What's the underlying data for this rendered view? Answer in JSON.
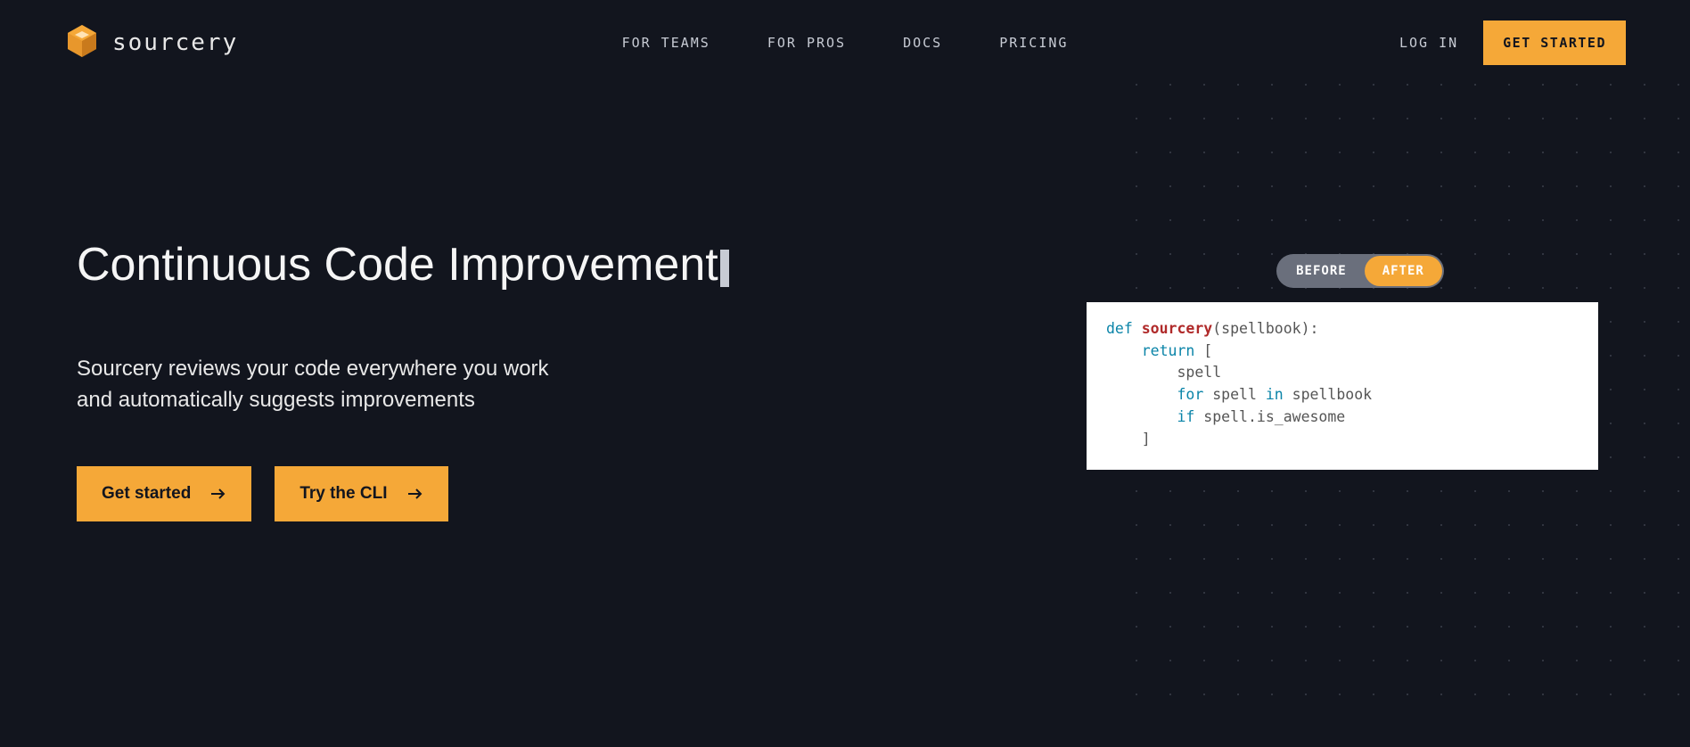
{
  "header": {
    "brand": "sourcery",
    "nav": {
      "for_teams": "FOR TEAMS",
      "for_pros": "FOR PROS",
      "docs": "DOCS",
      "pricing": "PRICING"
    },
    "login": "LOG IN",
    "cta": "GET STARTED"
  },
  "hero": {
    "title": "Continuous Code Improvement",
    "desc": "Sourcery reviews your code everywhere you work and automatically suggests improvements",
    "get_started": "Get started",
    "try_cli": "Try the CLI"
  },
  "toggle": {
    "before": "BEFORE",
    "after": "AFTER",
    "active": "after"
  },
  "code": {
    "def": "def",
    "fn": "sourcery",
    "params": "(spellbook):",
    "l2a": "return",
    "l2b": " [",
    "l3": "spell",
    "l4a": "for",
    "l4b": " spell ",
    "l4c": "in",
    "l4d": " spellbook",
    "l5a": "if",
    "l5b": " spell.is_awesome",
    "l6": "]"
  }
}
